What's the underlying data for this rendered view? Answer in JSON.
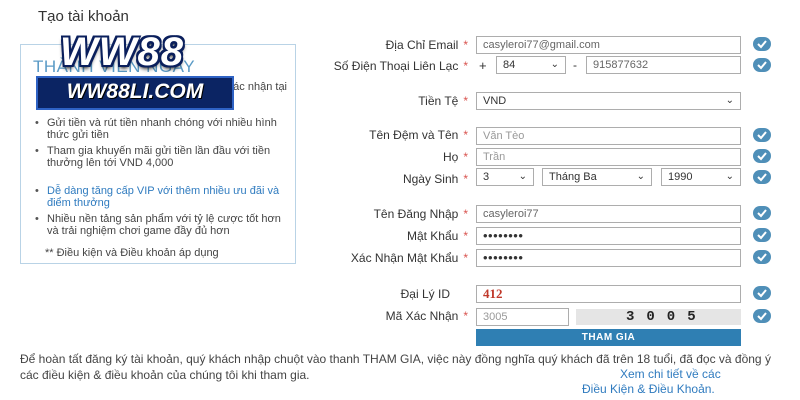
{
  "page": {
    "title": "Tạo tài khoản"
  },
  "promo": {
    "title": "THÀNH VIÊN NGAY",
    "items": [
      {
        "text": "Phí khi xác nhận tại mục"
      },
      {
        "text": "Gửi tiền và rút tiền nhanh chóng với nhiều hình thức gửi tiền"
      },
      {
        "text": "Tham gia khuyến mãi gửi tiền lần đầu với tiền thưởng lên tới VND 4,000"
      },
      {
        "text": "Dễ dàng tăng cấp VIP với thêm nhiều ưu đãi và điểm thưởng"
      },
      {
        "text": "Nhiều nền tảng sản phẩm với tỷ lệ cược tốt hơn và trải nghiệm chơi game đầy đủ hơn"
      }
    ],
    "note": "** Điều kiện và Điều khoản áp dụng"
  },
  "logo": {
    "top": "WW88",
    "bottom": "WW88LI.COM"
  },
  "form": {
    "email": {
      "label": "Địa Chỉ Email",
      "value": "casyleroi77@gmail.com"
    },
    "phone": {
      "label": "Số Điện Thoại Liên Lạc",
      "prefix": "+",
      "code": "84",
      "separator": "-",
      "value": "915877632"
    },
    "currency": {
      "label": "Tiền Tệ",
      "value": "VND"
    },
    "fullname": {
      "label": "Tên Đệm và Tên",
      "placeholder": "Văn Tèo"
    },
    "lastname": {
      "label": "Họ",
      "placeholder": "Trần"
    },
    "dob": {
      "label": "Ngày Sinh",
      "day": "3",
      "month": "Tháng Ba",
      "year": "1990"
    },
    "username": {
      "label": "Tên Đăng Nhập",
      "value": "casyleroi77"
    },
    "password": {
      "label": "Mật Khẩu",
      "value": "••••••••"
    },
    "confirm_password": {
      "label": "Xác Nhận Mật Khẩu",
      "value": "••••••••"
    },
    "agent": {
      "label": "Đại Lý ID",
      "value": "412"
    },
    "captcha": {
      "label": "Mã Xác Nhận",
      "value": "3005",
      "image_text": "3005"
    },
    "required_mark": "*",
    "submit_label": "THAM GIA"
  },
  "footer": {
    "text": "Để hoàn tất đăng ký tài khoản, quý khách nhập chuột vào thanh THAM GIA, việc này đồng nghĩa quý khách đã trên 18 tuổi, đã đọc và đồng ý các điều kiện & điều khoản của chúng tôi khi tham gia.",
    "link_1": "Xem chi tiết về các",
    "link_2": "Điều Kiện & Điều Khoản."
  },
  "colors": {
    "accent": "#2f7fb3",
    "check": "#4f8fb8",
    "required": "#d9534f",
    "link": "#2f7bbf"
  }
}
